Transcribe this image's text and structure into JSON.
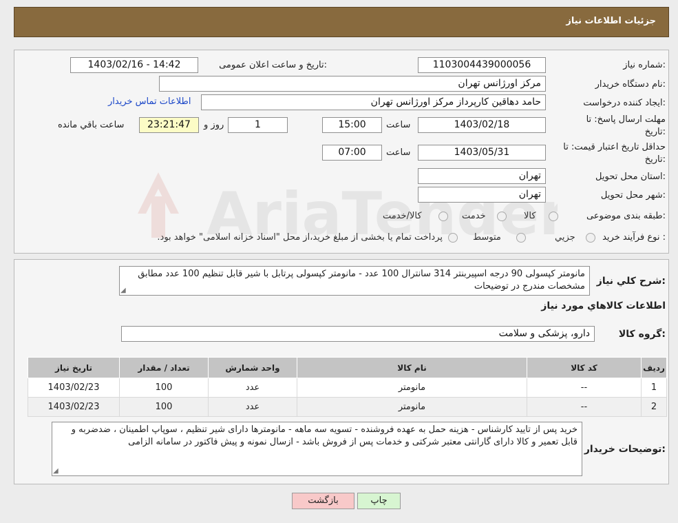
{
  "header": {
    "title": "جزئیات اطلاعات نیاز"
  },
  "form": {
    "need_number_label": "شماره نیاز:",
    "need_number": "1103004439000056",
    "announce_label": "تاریخ و ساعت اعلان عمومی:",
    "announce_value": "1403/02/16 - 14:42",
    "buyer_org_label": "نام دستگاه خریدار:",
    "buyer_org": "مرکز اورژانس تهران",
    "creator_label": "ایجاد کننده درخواست:",
    "creator": "حامد دهاقین کارپرداز مرکز اورژانس تهران",
    "contact_link": "اطلاعات تماس خریدار",
    "deadline_label_1": "مهلت ارسال پاسخ: تا",
    "deadline_label_2": "تاریخ:",
    "deadline_date": "1403/02/18",
    "time_label": "ساعت",
    "deadline_time": "15:00",
    "days_value": "1",
    "days_label": "روز و",
    "remaining_time": "23:21:47",
    "remaining_label": "ساعت باقي مانده",
    "validity_label_1": "حداقل تاریخ اعتبار قیمت: تا",
    "validity_label_2": "تاریخ:",
    "validity_date": "1403/05/31",
    "validity_time": "07:00",
    "province_label": "استان محل تحویل:",
    "province": "تهران",
    "city_label": "شهر محل تحویل:",
    "city": "تهران",
    "category_label": "طبقه بندی موضوعی:",
    "category_options": [
      "کالا",
      "خدمت",
      "کالا/خدمت"
    ],
    "process_label": "نوع فرآیند خرید :",
    "process_options": [
      "جزيي",
      "متوسط"
    ],
    "process_note": "پرداخت تمام یا بخشی از مبلغ خرید،از محل \"اسناد خزانه اسلامی\" خواهد بود."
  },
  "details": {
    "summary_label": "شرح کلي نياز:",
    "summary_text": "مانومتر کپسولی 90 درجه اسپیربنتر 314 سانترال 100 عدد - مانومتر کپسولی پرتابل با شیر قابل تنظیم 100 عدد مطابق مشخصات مندرج در توضیحات",
    "goods_info_title": "اطلاعات کالاهاي مورد نياز",
    "goods_group_label": "گروه کالا:",
    "goods_group": "دارو، پزشکی و سلامت",
    "table": {
      "headers": [
        "رديف",
        "کد کالا",
        "نام کالا",
        "واحد شمارش",
        "تعداد / مقدار",
        "تاريخ نياز"
      ],
      "rows": [
        [
          "1",
          "--",
          "مانومتر",
          "عدد",
          "100",
          "1403/02/23"
        ],
        [
          "2",
          "--",
          "مانومتر",
          "عدد",
          "100",
          "1403/02/23"
        ]
      ]
    },
    "buyer_notes_label": "توضیحات خریدار:",
    "buyer_notes": "خرید پس از تایید کارشناس - هزینه حمل به عهده فروشنده - تسویه سه ماهه - مانومترها دارای شیر تنظیم ، سوپاپ اطمینان ، ضدضربه و قابل تعمیر و کالا دارای گارانتی معتبر شرکتی و خدمات پس از فروش باشد - ازسال نمونه و پیش فاکتور در سامانه الزامی"
  },
  "buttons": {
    "print": "چاپ",
    "back": "بازگشت"
  },
  "watermark": {
    "text": "AriaTender.neT"
  },
  "colors": {
    "header": "#886a3e",
    "link": "#1b47c8",
    "remaining_bg": "#fcfcc6",
    "back_btn": "#f8c9c9",
    "print_btn": "#d7f5d1"
  }
}
